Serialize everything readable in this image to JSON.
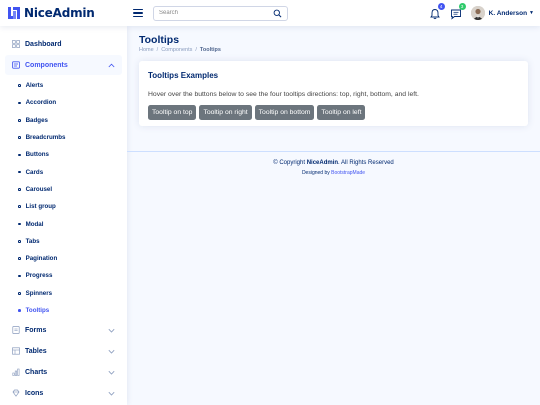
{
  "header": {
    "logo_text": "NiceAdmin",
    "search_placeholder": "Search",
    "notifications_count": "4",
    "messages_count": "3",
    "profile_name": "K. Anderson"
  },
  "sidebar": {
    "dashboard": "Dashboard",
    "components": "Components",
    "components_items": [
      "Alerts",
      "Accordion",
      "Badges",
      "Breadcrumbs",
      "Buttons",
      "Cards",
      "Carousel",
      "List group",
      "Modal",
      "Tabs",
      "Pagination",
      "Progress",
      "Spinners",
      "Tooltips"
    ],
    "forms": "Forms",
    "tables": "Tables",
    "charts": "Charts",
    "icons": "Icons"
  },
  "page": {
    "title": "Tooltips",
    "breadcrumb": [
      "Home",
      "Components",
      "Tooltips"
    ]
  },
  "card": {
    "title": "Tooltips Examples",
    "text": "Hover over the buttons below to see the four tooltips directions: top, right, bottom, and left.",
    "buttons": [
      "Tooltip on top",
      "Tooltip on right",
      "Tooltip on bottom",
      "Tooltip on left"
    ]
  },
  "footer": {
    "copyright_prefix": "© Copyright",
    "brand": "NiceAdmin",
    "copyright_suffix": ". All Rights Reserved",
    "designed_by": "Designed by",
    "designer": "BootstrapMade"
  },
  "colors": {
    "primary": "#4154f1",
    "navy": "#012970",
    "button_gray": "#6c757d",
    "background": "#f6f9ff",
    "badge_green": "#2eca6a"
  }
}
